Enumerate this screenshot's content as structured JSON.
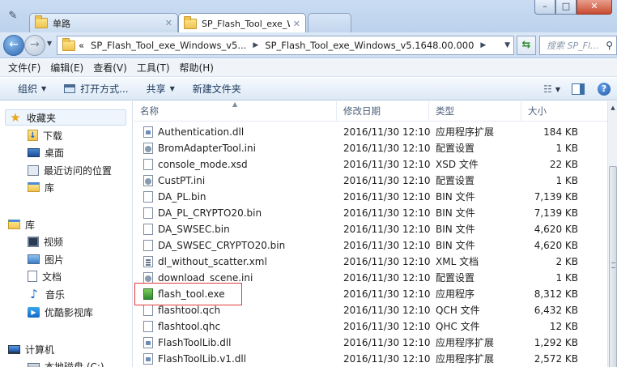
{
  "window": {
    "tabs": [
      {
        "label": "单路"
      },
      {
        "label": "SP_Flash_Tool_exe_Wind"
      },
      {
        "label": ""
      }
    ],
    "buttons": {
      "minimize": "–",
      "maximize": "□",
      "close": "✕"
    }
  },
  "address": {
    "overflow": "«",
    "crumbs": [
      "SP_Flash_Tool_exe_Windows_v5...",
      "SP_Flash_Tool_exe_Windows_v5.1648.00.000"
    ],
    "search_placeholder": "搜索 SP_Fl..."
  },
  "menu": [
    "文件(F)",
    "编辑(E)",
    "查看(V)",
    "工具(T)",
    "帮助(H)"
  ],
  "commands": {
    "organize": "组织",
    "open_with": "打开方式...",
    "share": "共享",
    "new_folder": "新建文件夹"
  },
  "nav": {
    "favorites": "收藏夹",
    "downloads": "下载",
    "desktop": "桌面",
    "recent": "最近访问的位置",
    "lib_short": "库",
    "libraries": "库",
    "videos": "视频",
    "pictures": "图片",
    "documents": "文档",
    "music": "音乐",
    "youku": "优酷影视库",
    "computer": "计算机",
    "local_disk": "本地磁盘 (C:)"
  },
  "columns": {
    "name": "名称",
    "date": "修改日期",
    "type": "类型",
    "size": "大小"
  },
  "files": [
    {
      "name": "Authentication.dll",
      "date": "2016/11/30 12:10",
      "type": "应用程序扩展",
      "size": "184 KB",
      "icon": "dll"
    },
    {
      "name": "BromAdapterTool.ini",
      "date": "2016/11/30 12:10",
      "type": "配置设置",
      "size": "1 KB",
      "icon": "ini"
    },
    {
      "name": "console_mode.xsd",
      "date": "2016/11/30 12:10",
      "type": "XSD 文件",
      "size": "22 KB",
      "icon": "file"
    },
    {
      "name": "CustPT.ini",
      "date": "2016/11/30 12:10",
      "type": "配置设置",
      "size": "1 KB",
      "icon": "ini"
    },
    {
      "name": "DA_PL.bin",
      "date": "2016/11/30 12:10",
      "type": "BIN 文件",
      "size": "7,139 KB",
      "icon": "file"
    },
    {
      "name": "DA_PL_CRYPTO20.bin",
      "date": "2016/11/30 12:10",
      "type": "BIN 文件",
      "size": "7,139 KB",
      "icon": "file"
    },
    {
      "name": "DA_SWSEC.bin",
      "date": "2016/11/30 12:10",
      "type": "BIN 文件",
      "size": "4,620 KB",
      "icon": "file"
    },
    {
      "name": "DA_SWSEC_CRYPTO20.bin",
      "date": "2016/11/30 12:10",
      "type": "BIN 文件",
      "size": "4,620 KB",
      "icon": "file"
    },
    {
      "name": "dl_without_scatter.xml",
      "date": "2016/11/30 12:10",
      "type": "XML 文档",
      "size": "2 KB",
      "icon": "xml"
    },
    {
      "name": "download_scene.ini",
      "date": "2016/11/30 12:10",
      "type": "配置设置",
      "size": "1 KB",
      "icon": "ini"
    },
    {
      "name": "flash_tool.exe",
      "date": "2016/11/30 12:10",
      "type": "应用程序",
      "size": "8,312 KB",
      "icon": "exe"
    },
    {
      "name": "flashtool.qch",
      "date": "2016/11/30 12:10",
      "type": "QCH 文件",
      "size": "6,432 KB",
      "icon": "file"
    },
    {
      "name": "flashtool.qhc",
      "date": "2016/11/30 12:10",
      "type": "QHC 文件",
      "size": "12 KB",
      "icon": "file"
    },
    {
      "name": "FlashToolLib.dll",
      "date": "2016/11/30 12:10",
      "type": "应用程序扩展",
      "size": "1,292 KB",
      "icon": "dll"
    },
    {
      "name": "FlashToolLib.v1.dll",
      "date": "2016/11/30 12:10",
      "type": "应用程序扩展",
      "size": "2,572 KB",
      "icon": "dll"
    }
  ],
  "colors": {
    "highlight": "#e23a3a",
    "accent": "#3c6ea8"
  }
}
